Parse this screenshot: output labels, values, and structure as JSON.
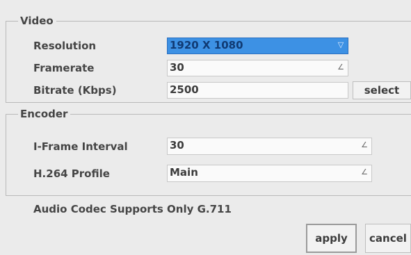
{
  "video": {
    "title": "Video",
    "resolution": {
      "label": "Resolution",
      "value": "1920 X 1080"
    },
    "framerate": {
      "label": "Framerate",
      "value": "30"
    },
    "bitrate": {
      "label": "Bitrate (Kbps)",
      "value": "2500",
      "select_label": "select"
    }
  },
  "encoder": {
    "title": "Encoder",
    "iframe_interval": {
      "label": "I-Frame Interval",
      "value": "30"
    },
    "h264_profile": {
      "label": "H.264 Profile",
      "value": "Main"
    }
  },
  "audio_note": "Audio Codec Supports Only G.711",
  "buttons": {
    "apply": "apply",
    "cancel": "cancel"
  },
  "colors": {
    "background": "#ebebeb",
    "selected": "#3d91e4",
    "text": "#454545"
  },
  "icons": {
    "dropdown": "dropdown-arrow-icon",
    "combo": "combo-edit-icon"
  }
}
